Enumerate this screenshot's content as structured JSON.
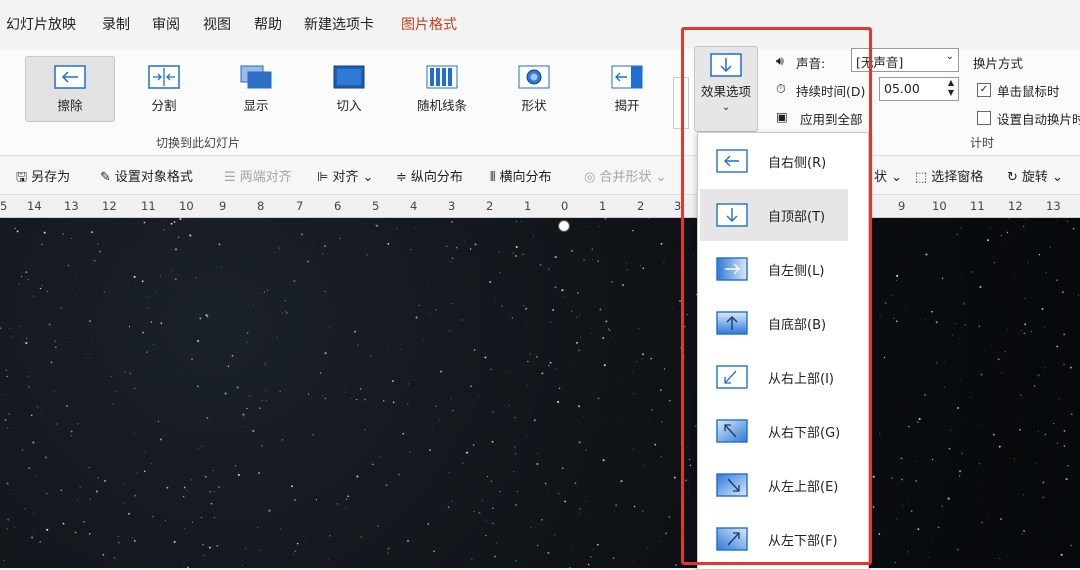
{
  "tabs": [
    "幻灯片放映",
    "录制",
    "审阅",
    "视图",
    "帮助",
    "新建选项卡",
    "图片格式"
  ],
  "transitions": [
    {
      "label": "擦除",
      "icon": "arrow-left-icon"
    },
    {
      "label": "分割",
      "icon": "split-icon"
    },
    {
      "label": "显示",
      "icon": "reveal-icon"
    },
    {
      "label": "切入",
      "icon": "cut-icon"
    },
    {
      "label": "随机线条",
      "icon": "random-bars-icon"
    },
    {
      "label": "形状",
      "icon": "shape-icon"
    },
    {
      "label": "揭开",
      "icon": "uncover-icon"
    }
  ],
  "group_caption": "切换到此幻灯片",
  "effect_options": {
    "label": "效果选项",
    "chevron": "⌄"
  },
  "sound": {
    "label": "声音:",
    "value": "[无声音]"
  },
  "duration": {
    "label": "持续时间(D)",
    "value": "05.00"
  },
  "apply_all": "应用到全部",
  "advance": {
    "title": "换片方式",
    "on_click": "单击鼠标时",
    "auto": "设置自动换片时",
    "on_click_checked": true,
    "auto_checked": false
  },
  "timing_caption": "计时",
  "toolbar": {
    "save_as": "另存为",
    "format_obj": "设置对象格式",
    "align_both": "两端对齐",
    "align": "对齐",
    "dist_v": "纵向分布",
    "dist_h": "横向分布",
    "merge": "合并形状",
    "shape_partial": "状",
    "select_pane": "选择窗格",
    "rotate": "旋转"
  },
  "ruler_left": [
    "5",
    "14",
    "13",
    "12",
    "11",
    "10",
    "9",
    "8",
    "7",
    "6",
    "5",
    "4",
    "3",
    "2",
    "1",
    "0",
    "1",
    "2",
    "3"
  ],
  "ruler_right": [
    "9",
    "10",
    "11",
    "12",
    "13"
  ],
  "dropdown_items": [
    {
      "label": "自右侧(R)",
      "icon": "arrow-left-icon",
      "selected": false
    },
    {
      "label": "自顶部(T)",
      "icon": "arrow-down-icon",
      "selected": true
    },
    {
      "label": "自左侧(L)",
      "icon": "arrow-right-icon",
      "selected": false
    },
    {
      "label": "自底部(B)",
      "icon": "arrow-up-icon",
      "selected": false
    },
    {
      "label": "从右上部(I)",
      "icon": "arrow-down-left-icon",
      "selected": false
    },
    {
      "label": "从右下部(G)",
      "icon": "arrow-up-left-icon",
      "selected": false
    },
    {
      "label": "从左上部(E)",
      "icon": "arrow-down-right-icon",
      "selected": false
    },
    {
      "label": "从左下部(F)",
      "icon": "arrow-up-right-icon",
      "selected": false
    }
  ],
  "colors": {
    "accent_tab": "#c43e1c",
    "highlight_border": "#e8352c",
    "icon_blue": "#1e6fd0"
  }
}
